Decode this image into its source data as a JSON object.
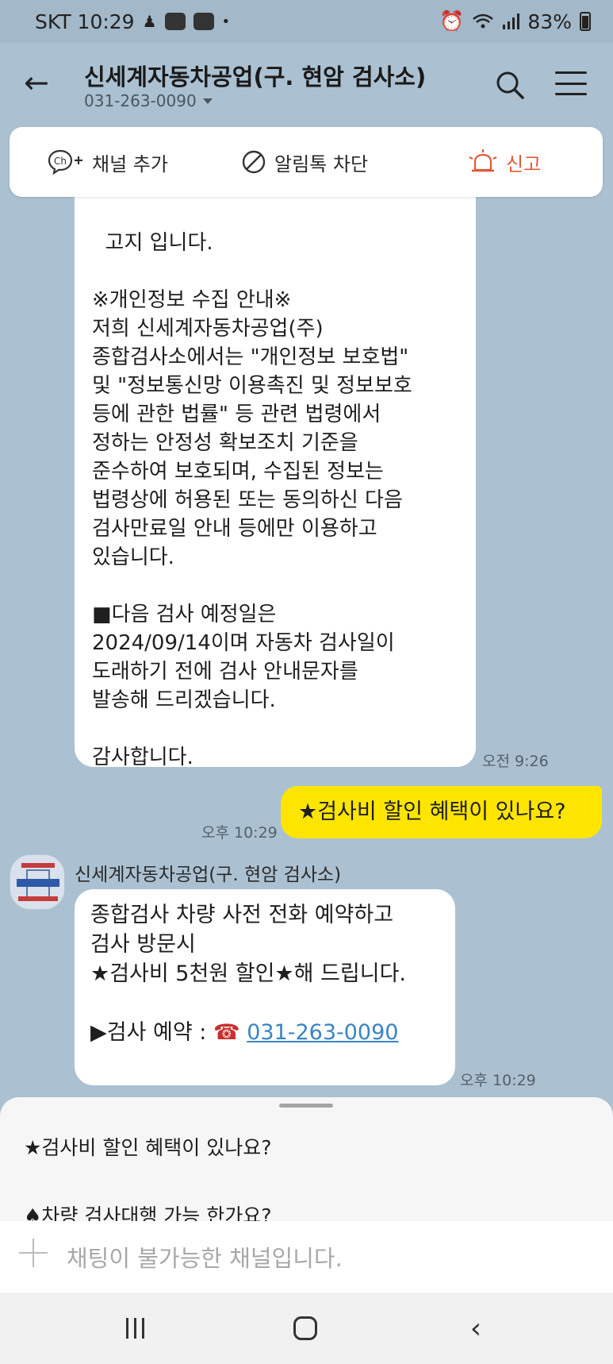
{
  "status_bar": {
    "carrier_time": "SKT 10:29",
    "battery": "83%"
  },
  "header": {
    "title": "신세계자동차공업(구. 현암 검사소)",
    "phone": "031-263-0090"
  },
  "actions": {
    "add_channel": "채널 추가",
    "block": "알림톡 차단",
    "report": "신고"
  },
  "messages": {
    "first": {
      "text": "고지 입니다.\n\n※개인정보 수집 안내※\n저희 신세계자동차공업(주)\n종합검사소에서는 \"개인정보 보호법\"\n및 \"정보통신망 이용촉진 및 정보보호\n등에 관한 법률\" 등 관련 법령에서\n정하는 안정성 확보조치 기준을\n준수하여 보호되며, 수집된 정보는\n법령상에 허용된 또는 동의하신 다음\n검사만료일 안내 등에만 이용하고\n있습니다.\n\n■다음 검사 예정일은\n2024/09/14이며 자동차 검사일이\n도래하기 전에 검사 안내문자를\n발송해 드리겠습니다.\n\n감사합니다.",
      "time": "오전 9:26"
    },
    "mine": {
      "text": "★검사비 할인 혜택이 있나요?",
      "time": "오후 10:29"
    },
    "reply": {
      "sender": "신세계자동차공업(구. 현암 검사소)",
      "text": "종합검사 차량 사전 전화 예약하고\n검사 방문시\n★검사비 5천원 할인★해 드립니다.\n\n▶검사 예약 : ",
      "phone_glyph": "☎",
      "link": "031-263-0090",
      "time": "오후 10:29"
    }
  },
  "quick_replies": [
    "★검사비 할인 혜택이 있나요?",
    "♠차량 검사대행 가능 한가요?"
  ],
  "input": {
    "placeholder": "채팅이 불가능한 채널입니다."
  },
  "icons": {
    "back": "←",
    "nav_back": "‹"
  }
}
